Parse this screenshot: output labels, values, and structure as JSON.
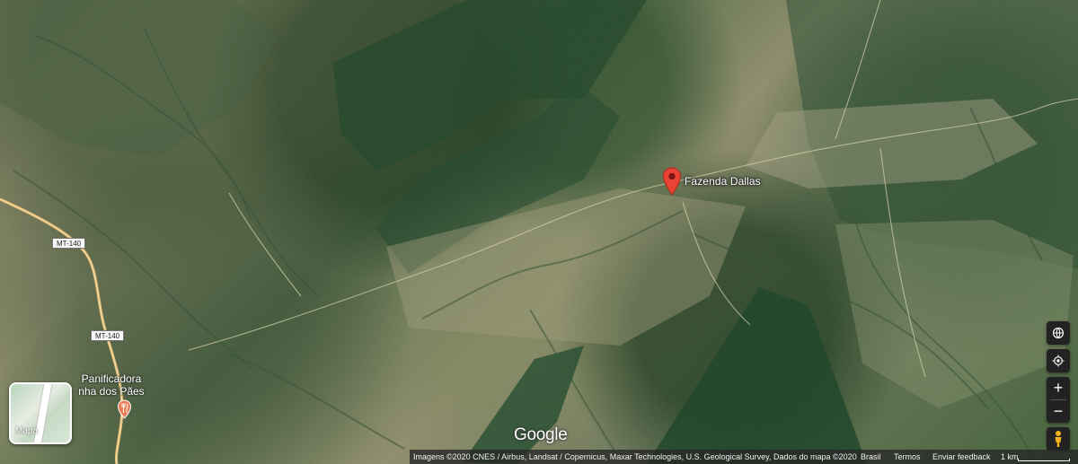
{
  "map": {
    "view": "satellite",
    "place_marker": {
      "name": "Fazenda Dallas",
      "icon": "red-location-pin-icon"
    },
    "road_labels": [
      "MT-140",
      "MT-140"
    ],
    "poi": {
      "name": "Panificadora\nnha dos Pães",
      "icon": "restaurant-fork-icon",
      "color": "#e97d55"
    }
  },
  "controls": {
    "map_type_label": "Mapa",
    "buttons": [
      {
        "name": "globe",
        "icon": "globe-icon"
      },
      {
        "name": "location",
        "icon": "my-location-icon"
      },
      {
        "name": "zoom-in",
        "label": "+"
      },
      {
        "name": "zoom-out",
        "label": "−"
      },
      {
        "name": "street-view",
        "icon": "pegman-icon"
      }
    ]
  },
  "branding": {
    "logo": "Google"
  },
  "footer": {
    "attribution": "Imagens ©2020 CNES / Airbus, Landsat / Copernicus, Maxar Technologies, U.S. Geological Survey, Dados do mapa ©2020",
    "country": "Brasil",
    "terms": "Termos",
    "feedback": "Enviar feedback",
    "scale": "1 km"
  },
  "colors": {
    "marker_red": "#ea4335",
    "control_background": "#222222",
    "footer_background": "#262626"
  }
}
